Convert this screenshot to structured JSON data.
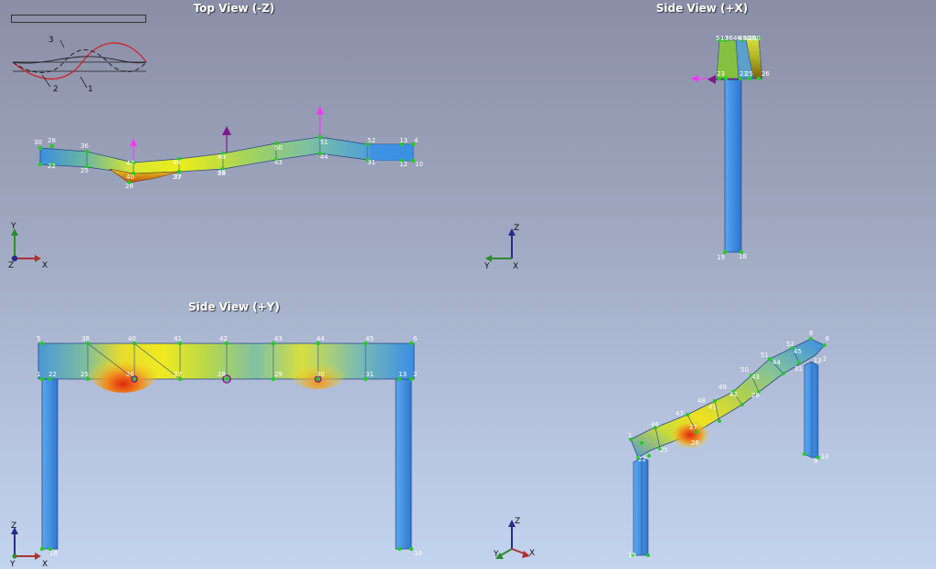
{
  "views": {
    "top": {
      "title": "Top View (-Z)"
    },
    "side_x": {
      "title": "Side View (+X)"
    },
    "side_y": {
      "title": "Side View (+Y)"
    },
    "iso": {
      "title": ""
    }
  },
  "axes": {
    "top": [
      "Y",
      "Z",
      "X"
    ],
    "side_x": [
      "Z",
      "Y",
      "X"
    ],
    "side_y": [
      "Z",
      "Y",
      "X"
    ],
    "iso": [
      "Z",
      "Y",
      "X"
    ]
  },
  "mode_legend": {
    "labels": [
      "3",
      "2",
      "1"
    ]
  },
  "node_labels": {
    "top": [
      "30",
      "28",
      "36",
      "47",
      "48",
      "49",
      "50",
      "51",
      "52",
      "13",
      "4",
      "22",
      "25",
      "40",
      "27",
      "28",
      "43",
      "44",
      "31",
      "12",
      "10",
      "26",
      "37",
      "46"
    ],
    "side_x": [
      "5",
      "17",
      "36",
      "46",
      "45",
      "47",
      "44",
      "15",
      "40",
      "23",
      "21",
      "25",
      "26",
      "19",
      "18"
    ],
    "side_y": [
      "5",
      "38",
      "40",
      "41",
      "42",
      "43",
      "44",
      "45",
      "6",
      "1",
      "22",
      "25",
      "26",
      "27",
      "28",
      "29",
      "30",
      "31",
      "13",
      "2",
      "18",
      "10"
    ],
    "iso": [
      "8",
      "6",
      "52",
      "45",
      "51",
      "44",
      "50",
      "43",
      "49",
      "42",
      "48",
      "41",
      "47",
      "46",
      "1",
      "2",
      "31",
      "13",
      "27",
      "28",
      "26",
      "25",
      "22",
      "10",
      "9",
      "19"
    ]
  },
  "colors": {
    "column": "#3f8ee8",
    "outline": "#2a4a8a",
    "node": "#22cc22",
    "load_magenta": "#ff33ff",
    "load_purple": "#7a1a8a",
    "mode1": "#d42020",
    "mode2": "#111111",
    "mode3": "#111111"
  }
}
